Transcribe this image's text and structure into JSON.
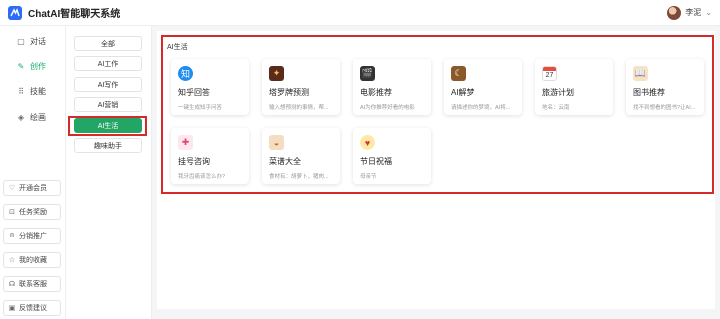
{
  "app": {
    "title": "ChatAI智能聊天系统"
  },
  "user": {
    "name": "李泥"
  },
  "sidebar": {
    "nav": [
      {
        "label": "对话",
        "icon": "chat-icon",
        "active": false
      },
      {
        "label": "创作",
        "icon": "pen-icon",
        "active": true
      },
      {
        "label": "技能",
        "icon": "grid-icon",
        "active": false
      },
      {
        "label": "绘画",
        "icon": "palette-icon",
        "active": false
      }
    ],
    "bottom": [
      {
        "label": "开通会员",
        "icon": "heart-icon"
      },
      {
        "label": "任务奖励",
        "icon": "gift-icon"
      },
      {
        "label": "分销推广",
        "icon": "person-icon"
      },
      {
        "label": "我的收藏",
        "icon": "star-icon"
      },
      {
        "label": "联系客服",
        "icon": "headset-icon"
      },
      {
        "label": "反馈建议",
        "icon": "feedback-icon"
      }
    ]
  },
  "categories": [
    {
      "label": "全部",
      "active": false
    },
    {
      "label": "AI工作",
      "active": false
    },
    {
      "label": "AI写作",
      "active": false
    },
    {
      "label": "AI营销",
      "active": false
    },
    {
      "label": "AI生活",
      "active": true
    },
    {
      "label": "趣味助手",
      "active": false
    }
  ],
  "main": {
    "section_title": "AI生活",
    "cards": [
      {
        "name": "知乎回答",
        "desc": "一键生成知乎问答",
        "icon": "zhihu-icon",
        "color": "#1e8cf0"
      },
      {
        "name": "塔罗牌预测",
        "desc": "输入想预测的事情，帮...",
        "icon": "tarot-card-icon",
        "color": "#5a2a1a"
      },
      {
        "name": "电影推荐",
        "desc": "AI为你推荐好看的电影",
        "icon": "clapperboard-icon",
        "color": "#333333"
      },
      {
        "name": "AI解梦",
        "desc": "请描述你的梦境，AI将...",
        "icon": "dream-icon",
        "color": "#8a5a2a"
      },
      {
        "name": "旅游计划",
        "desc": "地名：云南",
        "icon": "calendar-icon",
        "color": "#e84c3d"
      },
      {
        "name": "图书推荐",
        "desc": "找不到想看的图书?让AI...",
        "icon": "book-icon",
        "color": "#d9893a"
      },
      {
        "name": "挂号咨询",
        "desc": "我牙齿痛该怎么办?",
        "icon": "nurse-icon",
        "color": "#f0b6c8"
      },
      {
        "name": "菜谱大全",
        "desc": "食材有：胡萝卜，猪肉...",
        "icon": "dish-icon",
        "color": "#c2722a"
      },
      {
        "name": "节日祝福",
        "desc": "母亲节",
        "icon": "heart-badge-icon",
        "color": "#e0342f"
      }
    ]
  }
}
